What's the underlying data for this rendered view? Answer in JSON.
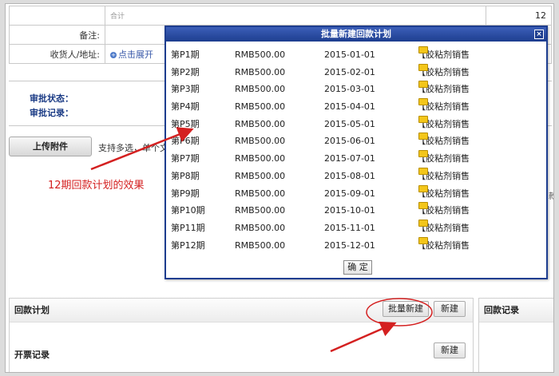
{
  "form": {
    "total_label": "合计",
    "total_value": "12",
    "remark_label": "备注:",
    "consignee_label": "收货人/地址:",
    "expand_link": "点击展开"
  },
  "approval": {
    "status_label": "审批状态：",
    "record_label": "审批记录："
  },
  "upload": {
    "button_label": "上传附件",
    "hint": "支持多选，单个文"
  },
  "edge_char": "款",
  "annotation": "12期回款计划的效果",
  "dialog": {
    "title": "批量新建回款计划",
    "close_glyph": "×",
    "ok_label": "确 定",
    "rows": [
      {
        "period": "第P1期",
        "amount": "RMB500.00",
        "date": "2015-01-01",
        "product": "【胶粘剂销售"
      },
      {
        "period": "第P2期",
        "amount": "RMB500.00",
        "date": "2015-02-01",
        "product": "【胶粘剂销售"
      },
      {
        "period": "第P3期",
        "amount": "RMB500.00",
        "date": "2015-03-01",
        "product": "【胶粘剂销售"
      },
      {
        "period": "第P4期",
        "amount": "RMB500.00",
        "date": "2015-04-01",
        "product": "【胶粘剂销售"
      },
      {
        "period": "第P5期",
        "amount": "RMB500.00",
        "date": "2015-05-01",
        "product": "【胶粘剂销售"
      },
      {
        "period": "第P6期",
        "amount": "RMB500.00",
        "date": "2015-06-01",
        "product": "【胶粘剂销售"
      },
      {
        "period": "第P7期",
        "amount": "RMB500.00",
        "date": "2015-07-01",
        "product": "【胶粘剂销售"
      },
      {
        "period": "第P8期",
        "amount": "RMB500.00",
        "date": "2015-08-01",
        "product": "【胶粘剂销售"
      },
      {
        "period": "第P9期",
        "amount": "RMB500.00",
        "date": "2015-09-01",
        "product": "【胶粘剂销售"
      },
      {
        "period": "第P10期",
        "amount": "RMB500.00",
        "date": "2015-10-01",
        "product": "【胶粘剂销售"
      },
      {
        "period": "第P11期",
        "amount": "RMB500.00",
        "date": "2015-11-01",
        "product": "【胶粘剂销售"
      },
      {
        "period": "第P12期",
        "amount": "RMB500.00",
        "date": "2015-12-01",
        "product": "【胶粘剂销售"
      }
    ]
  },
  "payment_plan": {
    "title": "回款计划",
    "batch_new_label": "批量新建",
    "new_label": "新建"
  },
  "invoice": {
    "title": "开票记录",
    "new_label": "新建"
  },
  "payment_record": {
    "title": "回款记录"
  },
  "colors": {
    "dialog_title_bg": "#1d3d8f",
    "annotation_red": "#d42020",
    "approval_text": "#1c3c86",
    "folder_yellow": "#f3c61a"
  }
}
